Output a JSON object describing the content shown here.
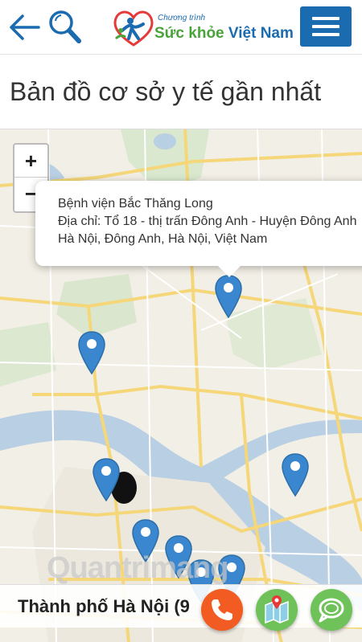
{
  "header": {
    "logo_small": "Chương trình",
    "logo_part1": "Sức khỏe",
    "logo_part2": "Việt Nam"
  },
  "page_title": "Bản đồ cơ sở y tế gần nhất",
  "map": {
    "zoom_in": "+",
    "zoom_out": "−",
    "popup": {
      "name": "Bệnh viện Bắc Thăng Long",
      "address_line1": "Địa chỉ: Tổ 18 - thị trấn Đông Anh - Huyện Đông Anh",
      "address_line2": "Hà Nội, Đông Anh, Hà Nội, Việt Nam"
    },
    "marker_color": "#3a87cf"
  },
  "watermark": "Quantrimang",
  "footer": {
    "location_text": "Thành phố Hà Nội (9"
  },
  "colors": {
    "brand_blue": "#1a6bb0",
    "brand_green": "#4aa23a",
    "phone_orange": "#f25c23",
    "fab_green": "#6fc25a"
  }
}
